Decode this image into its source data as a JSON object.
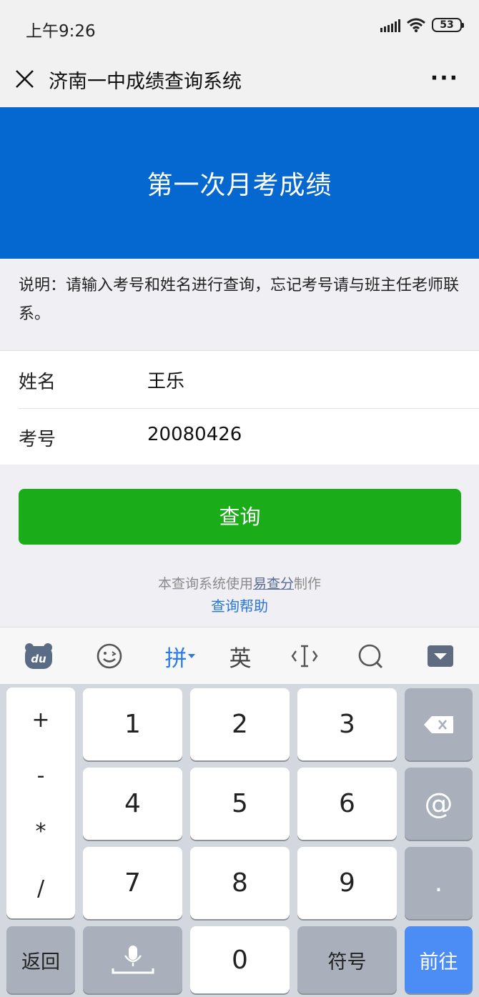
{
  "status_bar": {
    "time": "上午9:26",
    "battery": "53"
  },
  "nav": {
    "title": "济南一中成绩查询系统",
    "more": "···"
  },
  "banner": {
    "title": "第一次月考成绩"
  },
  "notice": "说明：请输入考号和姓名进行查询，忘记考号请与班主任老师联系。",
  "form": {
    "name_label": "姓名",
    "name_value": "王乐",
    "id_label": "考号",
    "id_value": "20080426"
  },
  "query_button": "查询",
  "footer": {
    "credit_prefix": "本查询系统使用",
    "credit_link": "易查分",
    "credit_suffix": "制作",
    "help_link": "查询帮助"
  },
  "ime_toolbar": {
    "pinyin": "拼",
    "english": "英"
  },
  "keyboard": {
    "symbols": [
      "+",
      "-",
      "*",
      "/"
    ],
    "keys": [
      "1",
      "2",
      "3",
      "4",
      "5",
      "6",
      "7",
      "8",
      "9",
      "0"
    ],
    "at": "@",
    "dot": ".",
    "back": "返回",
    "symbol_key": "符号",
    "go": "前往"
  },
  "colors": {
    "banner": "#0567d0",
    "button": "#1aad19",
    "link": "#2a75d8",
    "go_key": "#4c8df5"
  }
}
